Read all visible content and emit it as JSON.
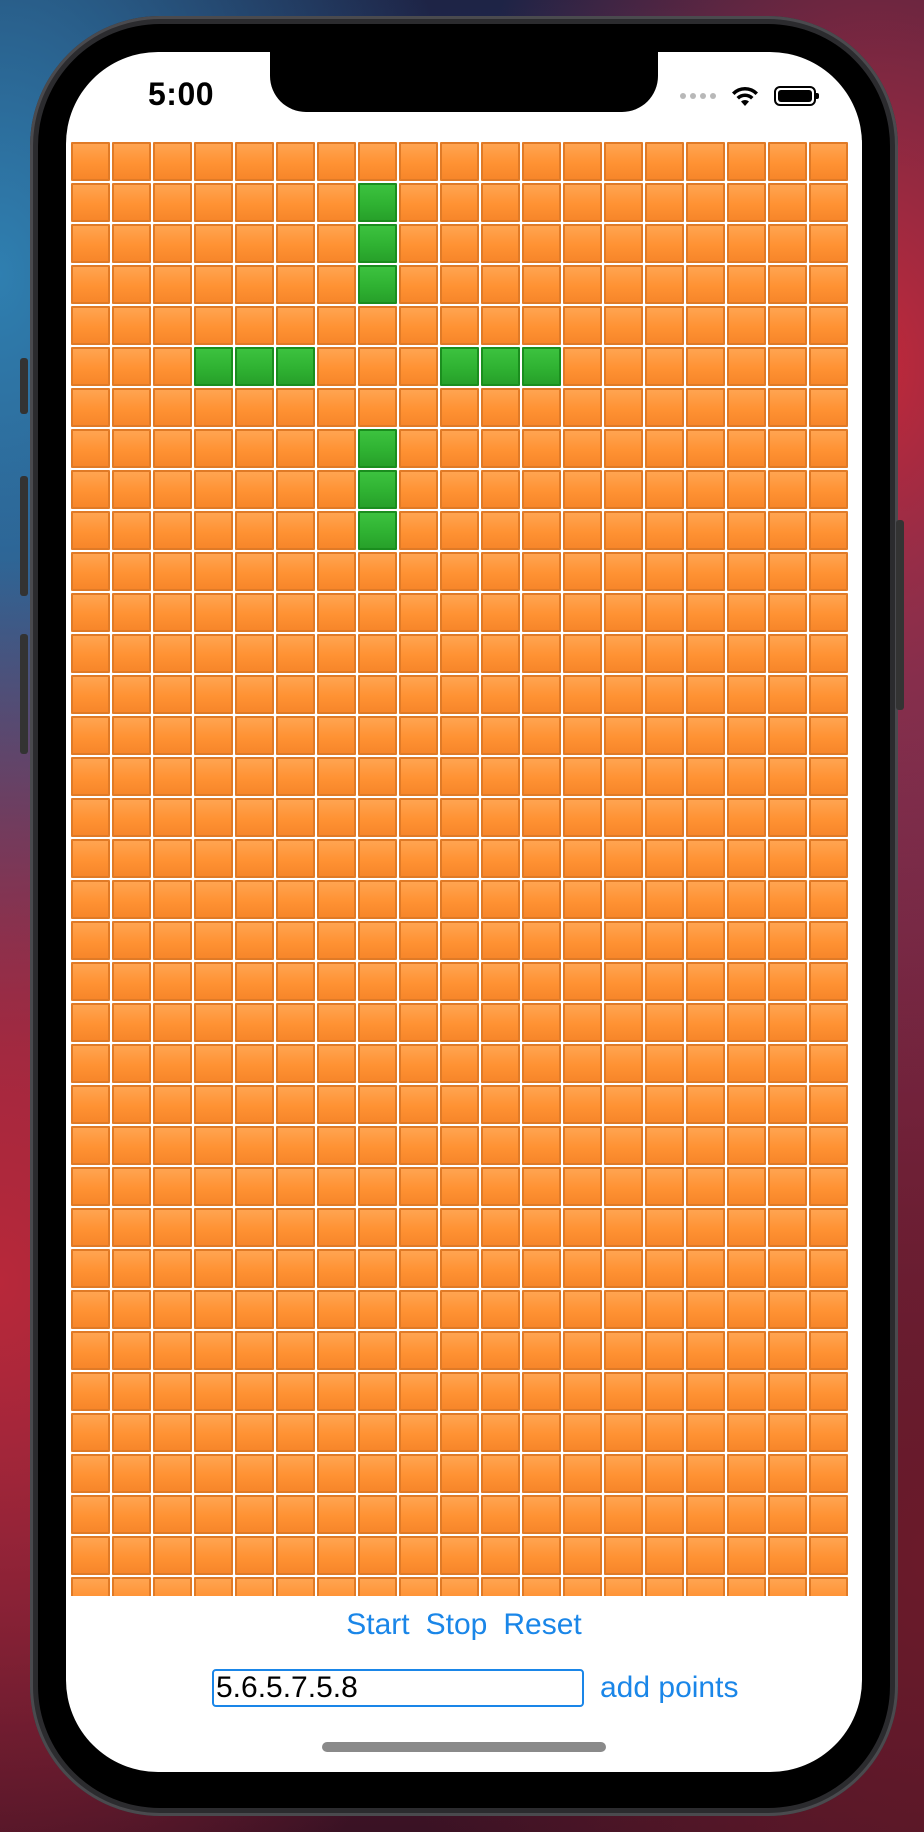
{
  "status_bar": {
    "time": "5:00"
  },
  "grid": {
    "cols": 19,
    "rows": 36,
    "alive_color": "#2fb232",
    "dead_color": "#ff9233",
    "alive_cells": [
      [
        1,
        7
      ],
      [
        2,
        7
      ],
      [
        3,
        7
      ],
      [
        5,
        3
      ],
      [
        5,
        4
      ],
      [
        5,
        5
      ],
      [
        5,
        9
      ],
      [
        5,
        10
      ],
      [
        5,
        11
      ],
      [
        7,
        7
      ],
      [
        8,
        7
      ],
      [
        9,
        7
      ]
    ]
  },
  "controls": {
    "start_label": "Start",
    "stop_label": "Stop",
    "reset_label": "Reset",
    "points_value": "5.6.5.7.5.8",
    "add_points_label": "add points"
  },
  "colors": {
    "accent": "#1a86e8"
  }
}
